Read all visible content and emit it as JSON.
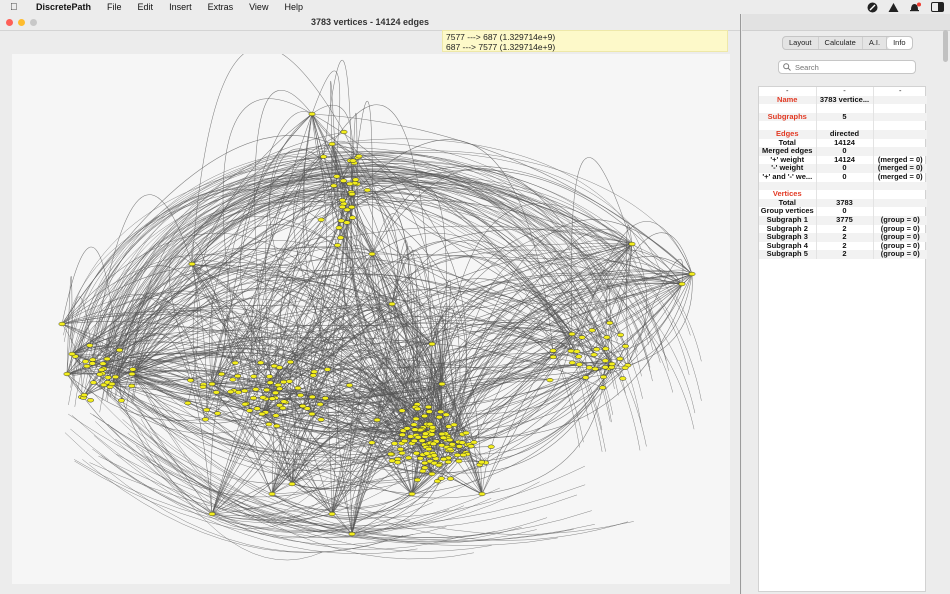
{
  "menubar": {
    "apple_icon": "apple-logo-icon",
    "app_name": "DiscretePath",
    "items": [
      "File",
      "Edit",
      "Insert",
      "Extras",
      "View",
      "Help"
    ],
    "status_icons": [
      "brush-icon",
      "warning-icon",
      "notification-bell-icon",
      "display-icon"
    ]
  },
  "window": {
    "title": "3783 vertices - 14124 edges",
    "tooltip_lines": [
      "7577 ---> 687 (1.329714e+9)",
      "687 ---> 7577 (1.329714e+9)"
    ]
  },
  "panel": {
    "tabs": [
      "Layout",
      "Calculate",
      "A.I.",
      "Info"
    ],
    "active_tab": "Info",
    "search_placeholder": "Search",
    "table_header": [
      "-",
      "-",
      "-"
    ],
    "rows": [
      {
        "c1": "Name",
        "c2": "3783 vertice...",
        "c3": "",
        "style": "red"
      },
      {
        "c1": "",
        "c2": "",
        "c3": "",
        "style": "blank"
      },
      {
        "c1": "Subgraphs",
        "c2": "5",
        "c3": "",
        "style": "red"
      },
      {
        "c1": "",
        "c2": "",
        "c3": "",
        "style": "blank"
      },
      {
        "c1": "Edges",
        "c2": "directed",
        "c3": "",
        "style": "red"
      },
      {
        "c1": "Total",
        "c2": "14124",
        "c3": "",
        "style": "lbl"
      },
      {
        "c1": "Merged edges",
        "c2": "0",
        "c3": "",
        "style": "lbl"
      },
      {
        "c1": "'+' weight",
        "c2": "14124",
        "c3": "(merged = 0)",
        "style": "lbl"
      },
      {
        "c1": "'-' weight",
        "c2": "0",
        "c3": "(merged = 0)",
        "style": "lbl"
      },
      {
        "c1": "'+' and '-' we...",
        "c2": "0",
        "c3": "(merged = 0)",
        "style": "lbl"
      },
      {
        "c1": "",
        "c2": "",
        "c3": "",
        "style": "blank"
      },
      {
        "c1": "Vertices",
        "c2": "",
        "c3": "",
        "style": "red"
      },
      {
        "c1": "Total",
        "c2": "3783",
        "c3": "",
        "style": "lbl"
      },
      {
        "c1": "Group vertices",
        "c2": "0",
        "c3": "",
        "style": "lbl"
      },
      {
        "c1": "Subgraph 1",
        "c2": "3775",
        "c3": "(group = 0)",
        "style": "lbl"
      },
      {
        "c1": "Subgraph 2",
        "c2": "2",
        "c3": "(group = 0)",
        "style": "lbl"
      },
      {
        "c1": "Subgraph 3",
        "c2": "2",
        "c3": "(group = 0)",
        "style": "lbl"
      },
      {
        "c1": "Subgraph 4",
        "c2": "2",
        "c3": "(group = 0)",
        "style": "lbl"
      },
      {
        "c1": "Subgraph 5",
        "c2": "2",
        "c3": "(group = 0)",
        "style": "lbl"
      }
    ]
  },
  "graph_colors": {
    "background": "#f6f6f6",
    "edge": "#555555",
    "vertex_fill": "#f3ee1e",
    "vertex_stroke": "#333333"
  }
}
